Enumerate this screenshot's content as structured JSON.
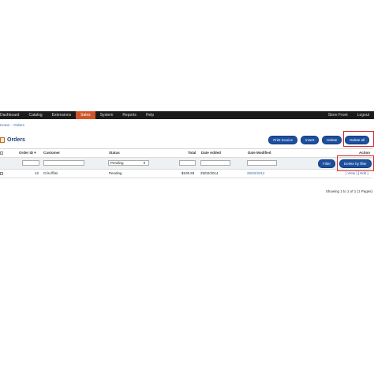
{
  "nav": {
    "items": [
      "Dashboard",
      "Catalog",
      "Extensions",
      "Sales",
      "System",
      "Reports",
      "Help"
    ],
    "active_index": 3,
    "right": [
      "Store Front",
      "Logout"
    ]
  },
  "breadcrumb": {
    "home": "Home",
    "sep": "::",
    "current": "Orders"
  },
  "page": {
    "title": "Orders"
  },
  "toolbar": {
    "print_invoice": "Print Invoice",
    "insert": "Insert",
    "delete": "Delete",
    "delete_all": "Delete all"
  },
  "table": {
    "headers": {
      "order_id": "Order ID",
      "sort_indicator": "▾",
      "customer": "Customer",
      "status": "Status",
      "total": "Total",
      "date_added": "Date Added",
      "date_modified": "Date Modified",
      "action": "Action"
    },
    "filter": {
      "status_value": "Pending",
      "filter_button": "Filter",
      "delete_by_filter_button": "Delete by filter"
    },
    "rows": [
      {
        "order_id": "12",
        "customer": "Cris iffimi",
        "status": "Pending",
        "total": "$105.93",
        "date_added": "25/02/2014",
        "date_modified": "25/02/2014",
        "action": "[ View ] [ Edit ]"
      }
    ]
  },
  "pagination": {
    "text": "Showing 1 to 1 of 1 (1 Pages)"
  },
  "colors": {
    "nav_bg": "#1b1b1b",
    "active_tab": "#d0542a",
    "button": "#1d4f9e",
    "highlight": "#d62a2a"
  }
}
